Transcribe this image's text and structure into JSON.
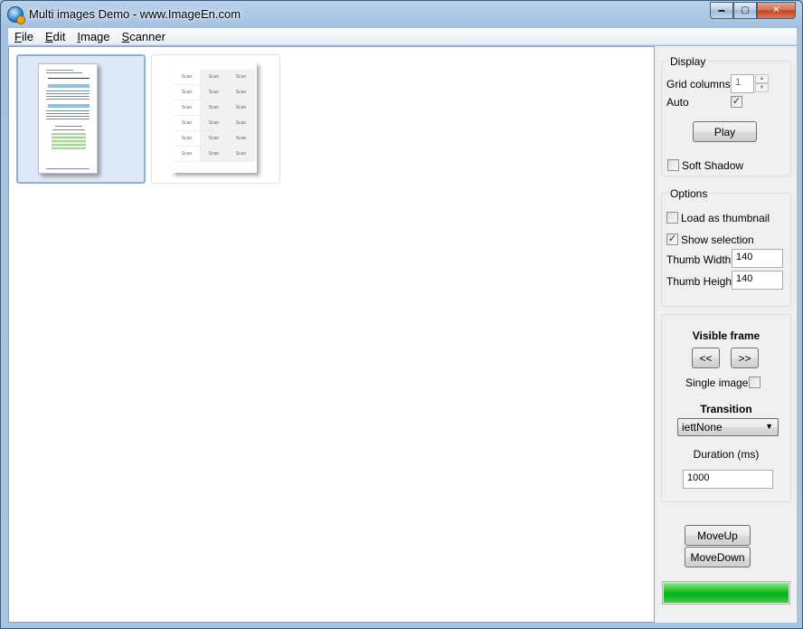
{
  "window": {
    "title": "Multi images Demo - www.ImageEn.com",
    "caption_minimize": "▬",
    "caption_maximize": "▢",
    "caption_close": "✕"
  },
  "menu": [
    {
      "label": "File",
      "accel": "F",
      "rest": "ile"
    },
    {
      "label": "Edit",
      "accel": "E",
      "rest": "dit"
    },
    {
      "label": "Image",
      "accel": "I",
      "rest": "mage"
    },
    {
      "label": "Scanner",
      "accel": "S",
      "rest": "canner"
    }
  ],
  "thumbnails": [
    {
      "kind": "document",
      "selected": true
    },
    {
      "kind": "label-sheet",
      "selected": false,
      "cell_label": "Scan"
    }
  ],
  "display": {
    "legend": "Display",
    "grid_columns_label": "Grid columns:",
    "grid_columns_value": "1",
    "auto_label": "Auto",
    "auto_checked": true,
    "play_label": "Play",
    "soft_shadow_label": "Soft Shadow",
    "soft_shadow_checked": false
  },
  "options": {
    "legend": "Options",
    "load_thumbnail_label": "Load as thumbnail",
    "load_thumbnail_checked": false,
    "show_selection_label": "Show selection",
    "show_selection_checked": true,
    "thumb_width_label": "Thumb Width",
    "thumb_width_value": "140",
    "thumb_height_label": "Thumb Height",
    "thumb_height_value": "140"
  },
  "frame": {
    "visible_frame_label": "Visible frame",
    "prev_label": "<<",
    "next_label": ">>",
    "single_image_label": "Single image",
    "single_image_checked": false,
    "transition_label": "Transition",
    "transition_value": "iettNone",
    "duration_label": "Duration (ms)",
    "duration_value": "1000"
  },
  "actions": {
    "move_up_label": "MoveUp",
    "move_down_label": "MoveDown"
  },
  "progress": {
    "value_fraction": 1.0,
    "color": "#06b025"
  }
}
